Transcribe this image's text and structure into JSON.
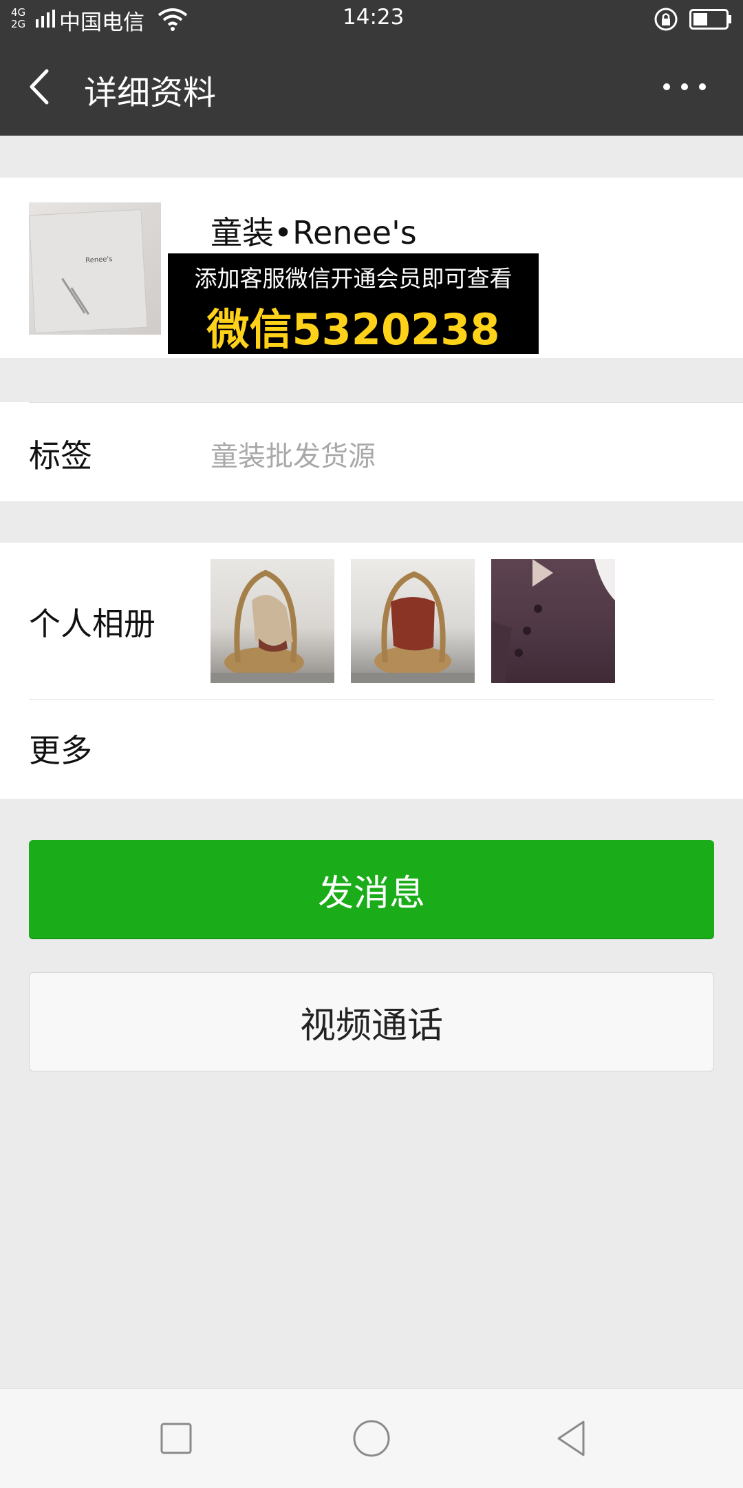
{
  "status_bar": {
    "network_top": "4G",
    "network_bottom": "2G",
    "carrier": "中国电信",
    "time": "14:23",
    "icons": [
      "signal-icon",
      "wifi-icon",
      "rotation-lock-icon",
      "battery-icon"
    ]
  },
  "nav": {
    "back_icon": "chevron-left-icon",
    "title": "详细资料",
    "more_icon": "more-dots-icon"
  },
  "profile": {
    "avatar_brand": "Renee's",
    "name": "童装•Renee's",
    "promo_line1": "添加客服微信开通会员即可查看",
    "promo_line2": "微信5320238"
  },
  "tag_row": {
    "label": "标签",
    "value": "童装批发货源"
  },
  "album_row": {
    "label": "个人相册",
    "thumbnail_count": 3
  },
  "more_row": {
    "label": "更多"
  },
  "actions": {
    "send_message": "发消息",
    "video_call": "视频通话"
  },
  "system_nav": {
    "icons": [
      "recents-square-icon",
      "home-circle-icon",
      "back-triangle-icon"
    ]
  },
  "colors": {
    "nav_bg": "#393939",
    "page_bg": "#ebebeb",
    "primary_green": "#1aad19",
    "promo_yellow": "#ffd21a",
    "secondary_text": "#a8a8a8"
  }
}
